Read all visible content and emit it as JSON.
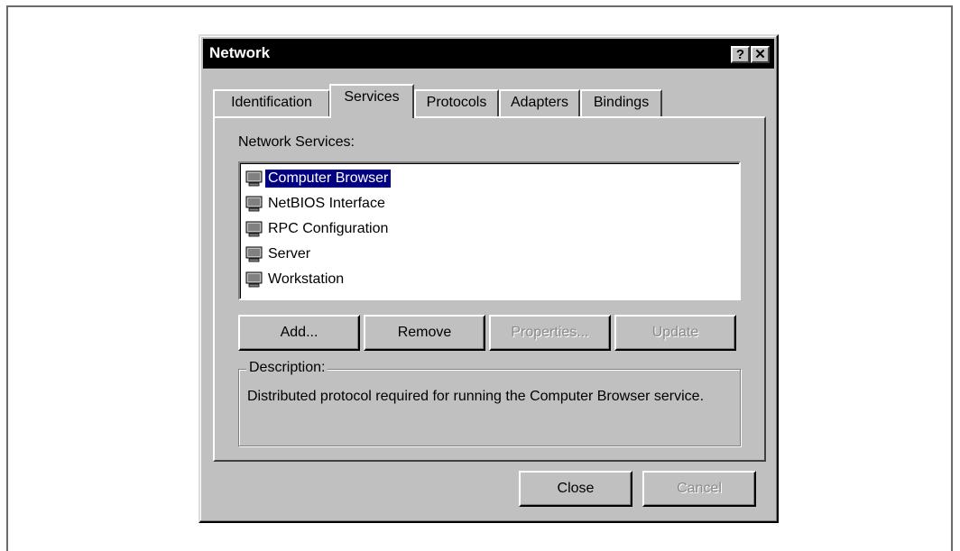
{
  "window": {
    "title": "Network",
    "help_button": "?",
    "close_button": "✕"
  },
  "tabs": [
    {
      "label": "Identification",
      "active": false
    },
    {
      "label": "Services",
      "active": true
    },
    {
      "label": "Protocols",
      "active": false
    },
    {
      "label": "Adapters",
      "active": false
    },
    {
      "label": "Bindings",
      "active": false
    }
  ],
  "services_panel": {
    "list_label": "Network Services:",
    "items": [
      {
        "label": "Computer Browser",
        "icon": "service-icon",
        "selected": true
      },
      {
        "label": "NetBIOS Interface",
        "icon": "service-icon",
        "selected": false
      },
      {
        "label": "RPC Configuration",
        "icon": "service-icon",
        "selected": false
      },
      {
        "label": "Server",
        "icon": "service-icon",
        "selected": false
      },
      {
        "label": "Workstation",
        "icon": "service-icon",
        "selected": false
      }
    ],
    "buttons": {
      "add": "Add...",
      "remove": "Remove",
      "properties": "Properties...",
      "update": "Update"
    },
    "description": {
      "legend": "Description:",
      "text": "Distributed protocol required for running the Computer Browser service."
    }
  },
  "footer": {
    "close": "Close",
    "cancel": "Cancel"
  }
}
